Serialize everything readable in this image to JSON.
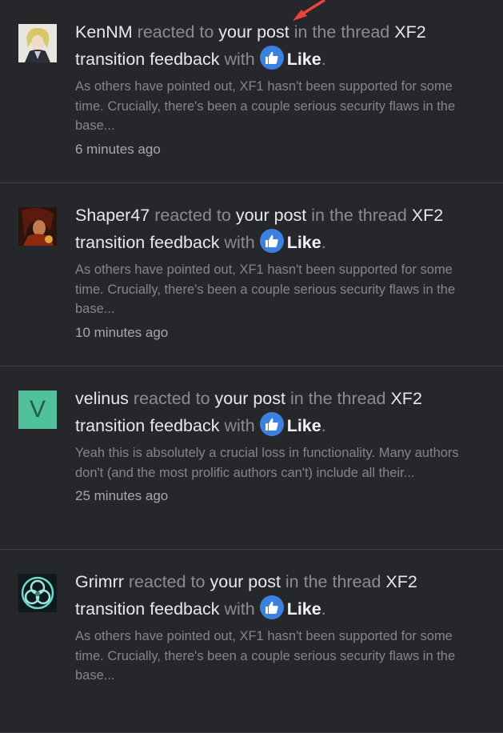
{
  "notifications": [
    {
      "user": "KenNM",
      "reacted_to": "reacted to",
      "your_post": "your post",
      "in_thread": "in the thread",
      "thread": "XF2 transition feedback",
      "with": "with",
      "reaction": "Like",
      "period": ".",
      "snippet": "As others have pointed out, XF1 hasn't been supported for some time. Crucially, there's been a couple serious security flaws in the base...",
      "time": "6 minutes ago",
      "avatar": "anime-character-avatar"
    },
    {
      "user": "Shaper47",
      "reacted_to": "reacted to",
      "your_post": "your post",
      "in_thread": "in the thread",
      "thread": "XF2 transition feedback",
      "with": "with",
      "reaction": "Like",
      "period": ".",
      "snippet": "As others have pointed out, XF1 hasn't been supported for some time. Crucially, there's been a couple serious security flaws in the base...",
      "time": "10 minutes ago",
      "avatar": "portrait-avatar"
    },
    {
      "user": "velinus",
      "reacted_to": "reacted to",
      "your_post": "your post",
      "in_thread": "in the thread",
      "thread": "XF2 transition feedback",
      "with": "with",
      "reaction": "Like",
      "period": ".",
      "snippet": "Yeah this is absolutely a crucial loss in functionality. Many authors don't (and the most prolific authors can't) include all their...",
      "time": "25 minutes ago",
      "avatar_letter": "V"
    },
    {
      "user": "Grimrr",
      "reacted_to": "reacted to",
      "your_post": "your post",
      "in_thread": "in the thread",
      "thread": "XF2 transition feedback",
      "with": "with",
      "reaction": "Like",
      "period": ".",
      "snippet": "As others have pointed out, XF1 hasn't been supported for some time. Crucially, there's been a couple serious security flaws in the base...",
      "time": "",
      "avatar": "celtic-knot-avatar"
    }
  ],
  "colors": {
    "background": "#26272b",
    "like_blue": "#3b82e0",
    "avatar_green": "#4fc29c",
    "annotation_arrow": "#e8453c"
  }
}
